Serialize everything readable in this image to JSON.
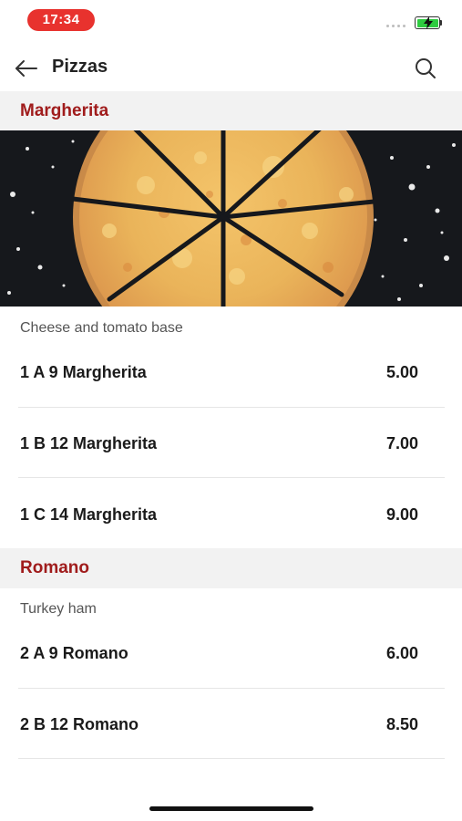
{
  "status_bar": {
    "time": "17:34",
    "battery_icon": "battery-charging-icon",
    "signal_icon": "signal-dots-icon"
  },
  "header": {
    "title": "Pizzas",
    "back_icon": "arrow-left-icon",
    "search_icon": "search-icon"
  },
  "sections": [
    {
      "title": "Margherita",
      "description": "Cheese and tomato base",
      "items": [
        {
          "name": "1 A 9 Margherita",
          "price": "5.00"
        },
        {
          "name": "1 B 12 Margherita",
          "price": "7.00"
        },
        {
          "name": "1 C 14 Margherita",
          "price": "9.00"
        }
      ]
    },
    {
      "title": "Romano",
      "description": "Turkey ham",
      "items": [
        {
          "name": "2 A 9 Romano",
          "price": "6.00"
        },
        {
          "name": "2 B 12 Romano",
          "price": "8.50"
        }
      ]
    }
  ],
  "colors": {
    "accent": "#a01c1c",
    "time_pill": "#e8322e",
    "section_bg": "#f2f2f2"
  }
}
